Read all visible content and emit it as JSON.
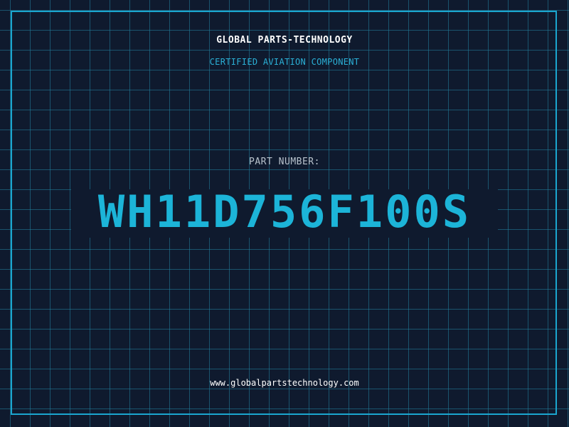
{
  "header": {
    "company": "GLOBAL PARTS-TECHNOLOGY",
    "subtitle": "CERTIFIED AVIATION COMPONENT"
  },
  "part": {
    "label": "PART NUMBER:",
    "number": "WH11D756F100S"
  },
  "footer": {
    "url": "www.globalpartstechnology.com"
  },
  "colors": {
    "background": "#0f1a2e",
    "grid": "#2282a0",
    "accent": "#1cb4d8",
    "frame": "#1ba6cf",
    "label": "#b8c2cc",
    "text": "#ffffff"
  }
}
